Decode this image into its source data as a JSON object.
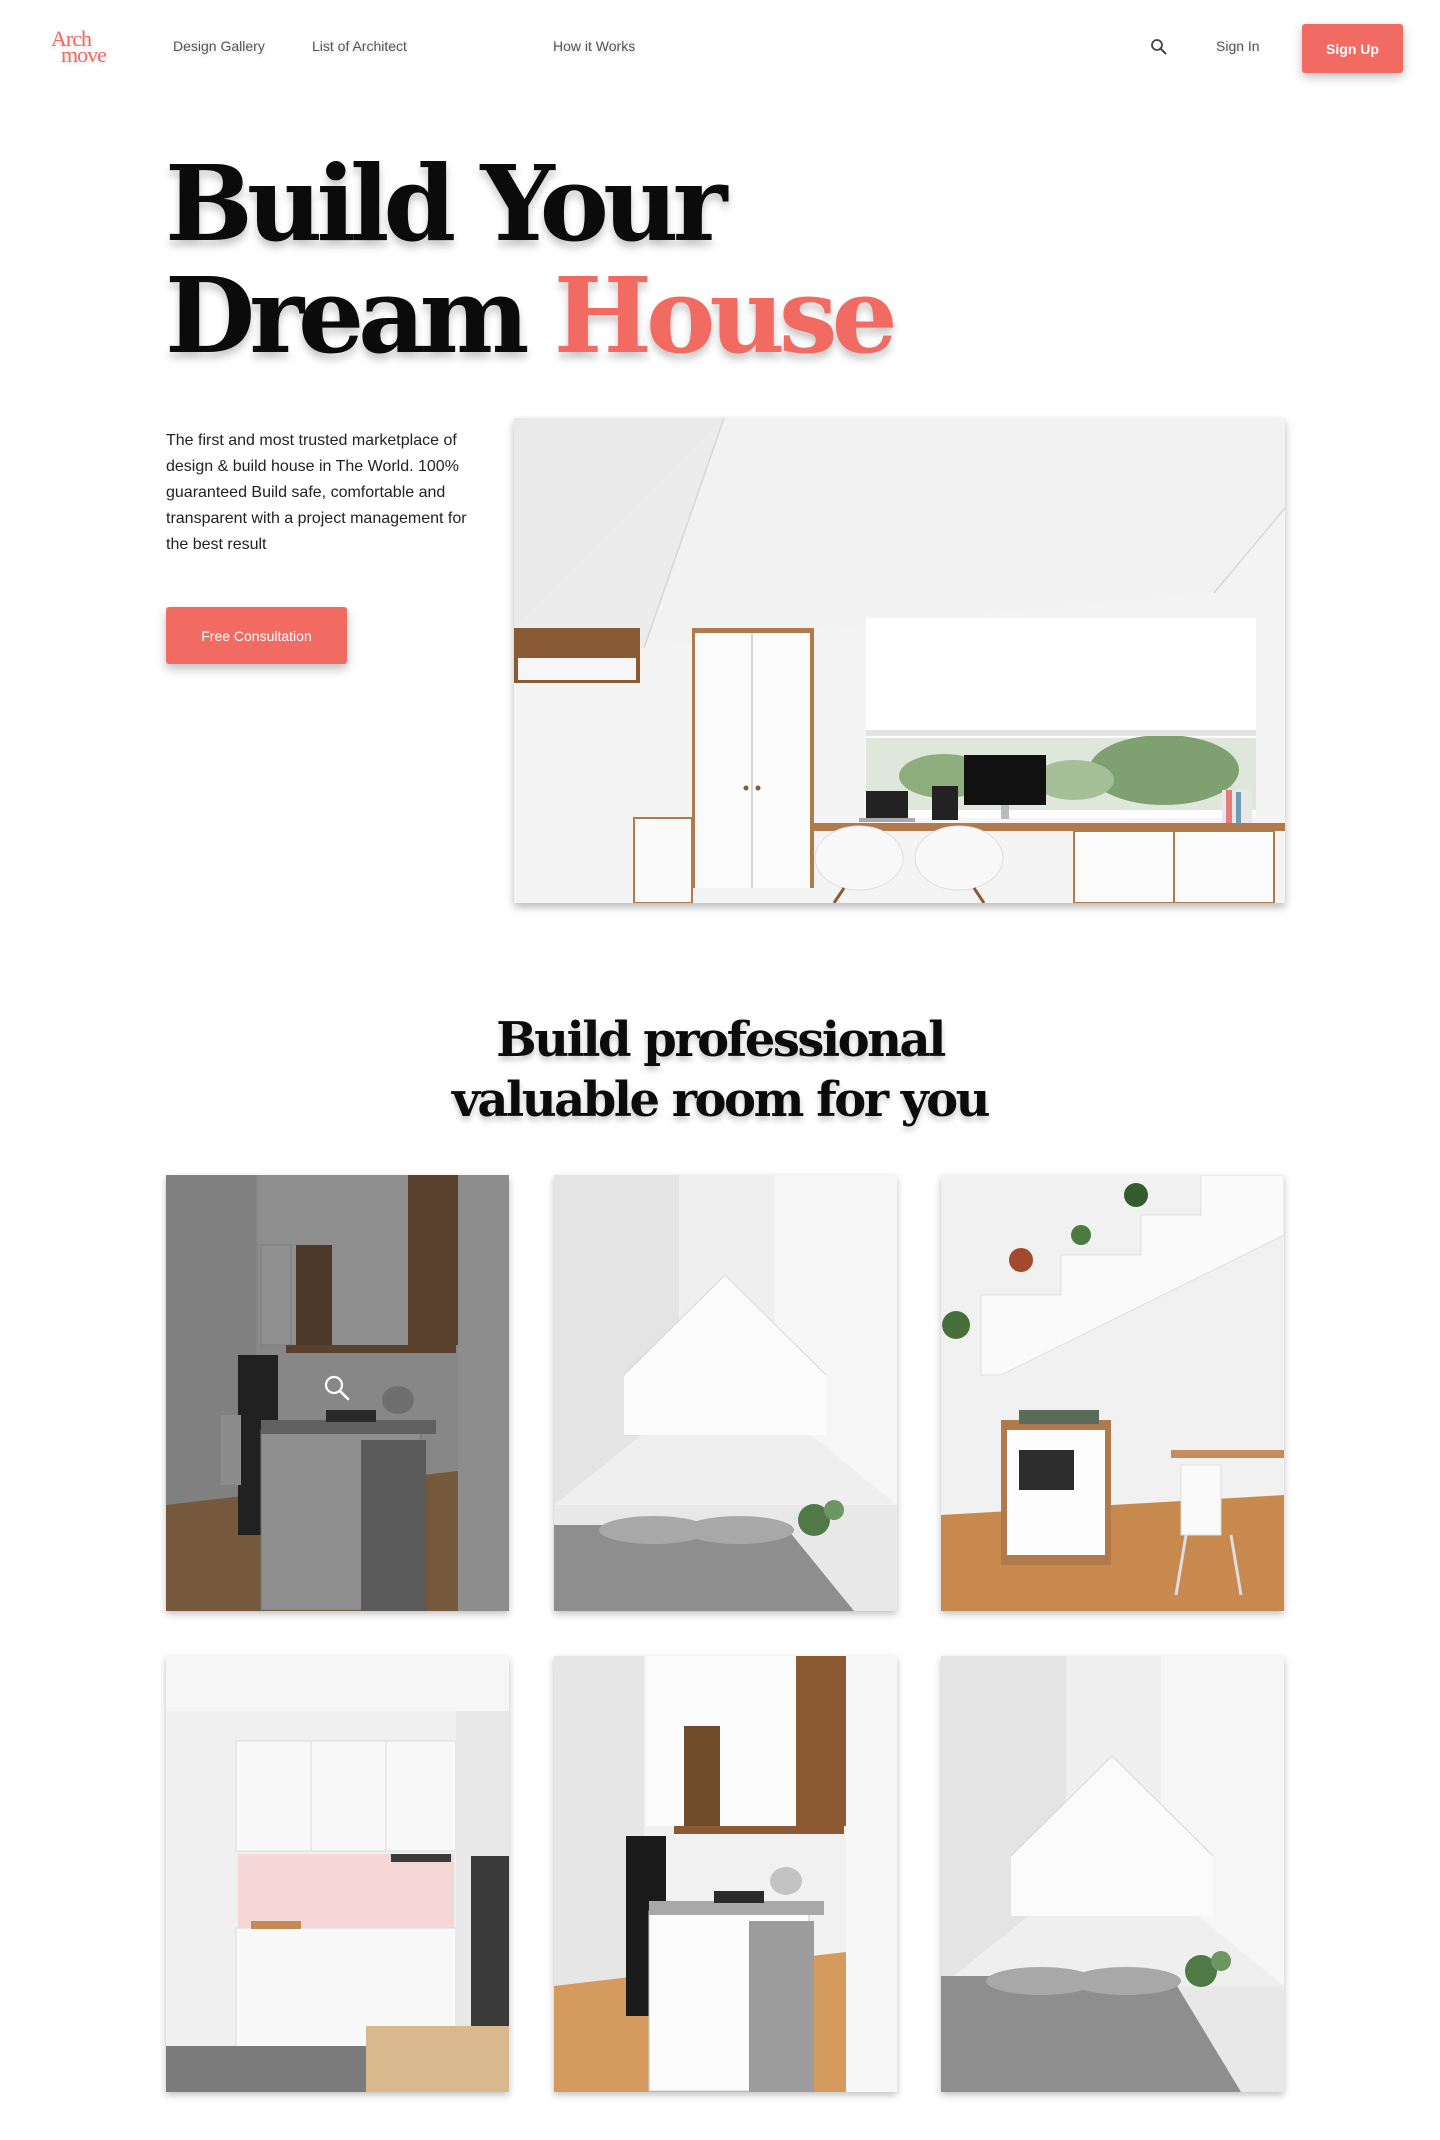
{
  "brand": {
    "logo_line1": "Arch",
    "logo_line2": "move",
    "color": "#f26b63"
  },
  "nav": {
    "links": [
      "Design Gallery",
      "List of Architect",
      "How it Works"
    ],
    "search_icon": "search-icon",
    "sign_in": "Sign In",
    "sign_up": "Sign Up"
  },
  "hero": {
    "title_line1": "Build Your",
    "title_line2_plain": "Dream",
    "title_line2_accent": "House",
    "description": "The first and most trusted marketplace of design & build house in The World. 100% guaranteed Build safe, comfortable and transparent with a project management for the best result",
    "cta": "Free Consultation"
  },
  "gallery": {
    "title": "Build professional valuable room for you",
    "hover_icon": "zoom-icon",
    "hovered_index": 0
  }
}
